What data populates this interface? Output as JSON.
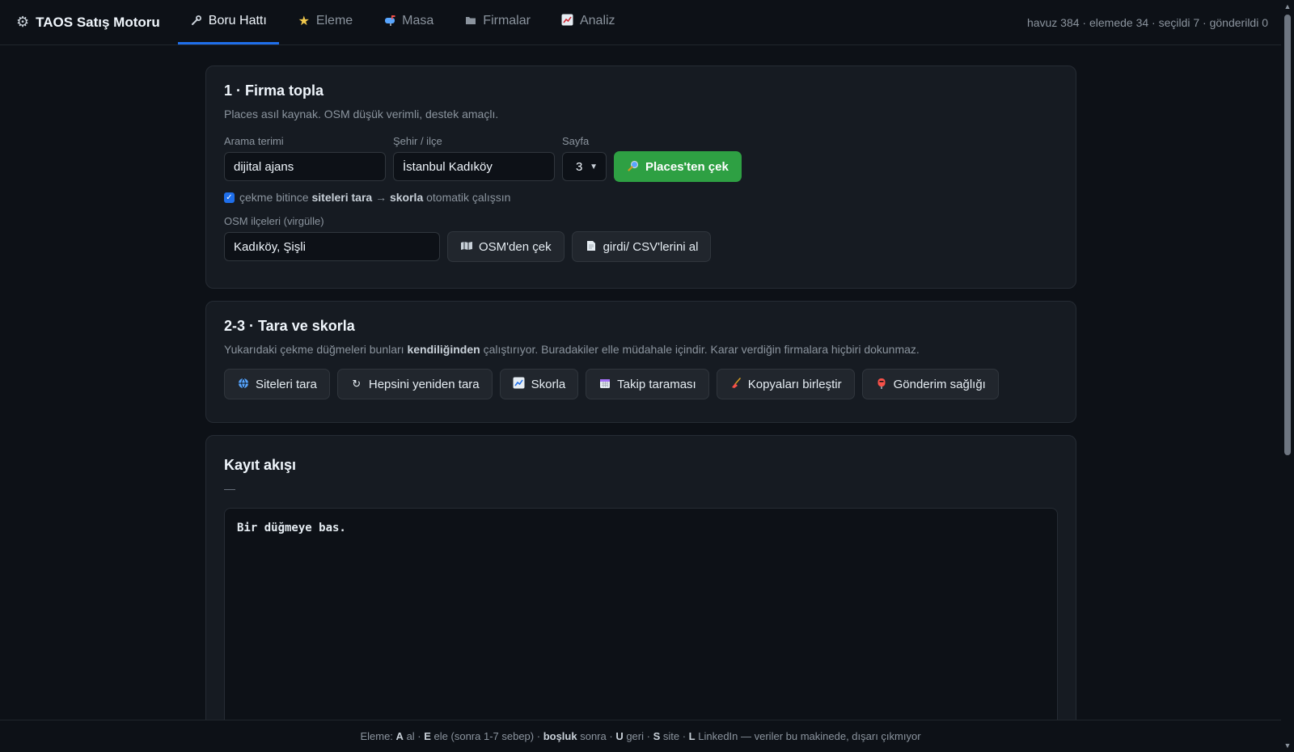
{
  "nav": {
    "brand": "TAOS Satış Motoru",
    "tabs": [
      {
        "label": "Boru Hattı",
        "icon": "wrench-icon",
        "active": true
      },
      {
        "label": "Eleme",
        "icon": "star-icon",
        "active": false
      },
      {
        "label": "Masa",
        "icon": "mailbox-icon",
        "active": false
      },
      {
        "label": "Firmalar",
        "icon": "folder-icon",
        "active": false
      },
      {
        "label": "Analiz",
        "icon": "chart-icon",
        "active": false
      }
    ],
    "stats": "havuz 384 · elemede 34 · seçildi 7 · gönderildi 0"
  },
  "collect": {
    "title": "1 · Firma topla",
    "desc": "Places asıl kaynak. OSM düşük verimli, destek amaçlı.",
    "search_label": "Arama terimi",
    "search_value": "dijital ajans",
    "city_label": "Şehir / ilçe",
    "city_value": "İstanbul Kadıköy",
    "page_label": "Sayfa",
    "page_value": "3",
    "places_button": "Places'ten çek",
    "auto": {
      "part1": "çekme bitince",
      "bold1": "siteleri tara",
      "arrow": "→",
      "bold2": "skorla",
      "part2": "otomatik çalışsın",
      "checked": true
    },
    "osm_label": "OSM ilçeleri (virgülle)",
    "osm_value": "Kadıköy, Şişli",
    "osm_button": "OSM'den çek",
    "csv_button": "girdi/ CSV'lerini al"
  },
  "scan": {
    "title": "2-3 · Tara ve skorla",
    "desc_part1": "Yukarıdaki çekme düğmeleri bunları",
    "desc_bold": "kendiliğinden",
    "desc_part2": "çalıştırıyor. Buradakiler elle müdahale içindir. Karar verdiğin firmalara hiçbiri dokunmaz.",
    "buttons": {
      "scan_sites": "Siteleri tara",
      "rescan_all": "Hepsini yeniden tara",
      "score": "Skorla",
      "followup": "Takip taraması",
      "merge": "Kopyaları birleştir",
      "delivery": "Gönderim sağlığı"
    }
  },
  "log": {
    "title": "Kayıt akışı",
    "status": "—",
    "content": "Bir düğmeye bas."
  },
  "footer": {
    "p1": "Eleme:",
    "k1": "A",
    "p2": "al ·",
    "k2": "E",
    "p3": "ele (sonra 1-7 sebep) ·",
    "k3": "boşluk",
    "p4": "sonra ·",
    "k4": "U",
    "p5": "geri ·",
    "k5": "S",
    "p6": "site ·",
    "k6": "L",
    "p7": "LinkedIn — veriler bu makinede, dışarı çıkmıyor"
  }
}
